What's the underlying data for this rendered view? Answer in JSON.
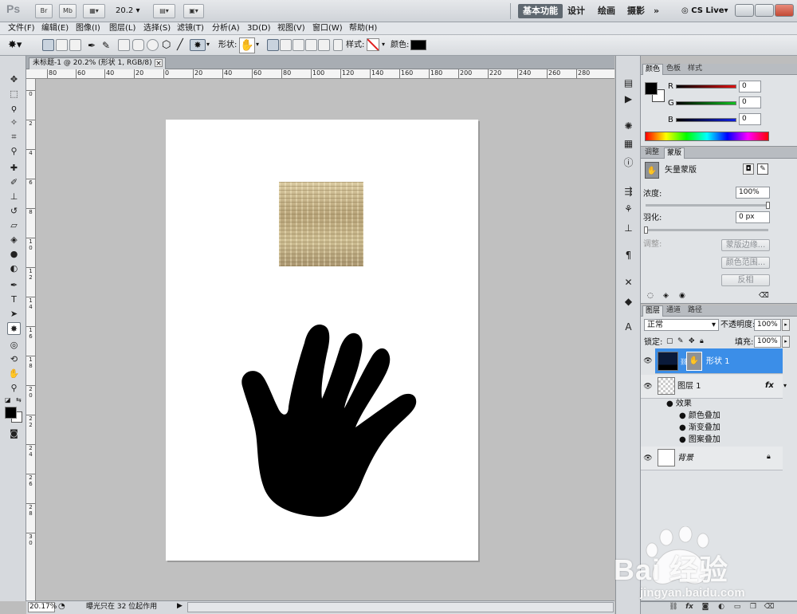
{
  "appbar": {
    "logo": "Ps",
    "br_label": "Br",
    "mb_label": "Mb",
    "zoom": "20.2",
    "workspaces": [
      "基本功能",
      "设计",
      "绘画",
      "摄影"
    ],
    "more": "»",
    "cslive": "CS Live"
  },
  "menu": [
    "文件(F)",
    "编辑(E)",
    "图像(I)",
    "图层(L)",
    "选择(S)",
    "滤镜(T)",
    "分析(A)",
    "3D(D)",
    "视图(V)",
    "窗口(W)",
    "帮助(H)"
  ],
  "options": {
    "shape_label": "形状:",
    "style_label": "样式:",
    "color_label": "颜色:",
    "color_value": "#000000"
  },
  "document": {
    "tab_title": "未标题-1 @ 20.2% (形状 1, RGB/8) *",
    "close": "×"
  },
  "rulers": {
    "h_ticks": [
      "80",
      "60",
      "40",
      "20",
      "0",
      "20",
      "40",
      "60",
      "80",
      "100",
      "120",
      "140",
      "160",
      "180",
      "200",
      "220",
      "240",
      "260",
      "280"
    ],
    "v_ticks": [
      "0",
      "2",
      "4",
      "6",
      "8",
      "1 0",
      "1 2",
      "1 4",
      "1 6",
      "1 8",
      "2 0",
      "2 2",
      "2 4",
      "2 6",
      "2 8",
      "3 0"
    ]
  },
  "status": {
    "zoom": "20.17%",
    "text": "曝光只在 32 位起作用"
  },
  "color_panel": {
    "tabs": [
      "颜色",
      "色板",
      "样式"
    ],
    "channels": [
      {
        "name": "R",
        "value": "0"
      },
      {
        "name": "G",
        "value": "0"
      },
      {
        "name": "B",
        "value": "0"
      }
    ]
  },
  "masks_panel": {
    "tabs": [
      "调整",
      "蒙版"
    ],
    "title": "矢量蒙版",
    "density_label": "浓度:",
    "density_value": "100%",
    "density_fraction": 1.0,
    "feather_label": "羽化:",
    "feather_value": "0 px",
    "refine_label": "调整:",
    "buttons": [
      "蒙版边缘...",
      "颜色范围...",
      "反相"
    ]
  },
  "layers_panel": {
    "tabs": [
      "图层",
      "通道",
      "路径"
    ],
    "blend_mode": "正常",
    "opacity_label": "不透明度:",
    "opacity_value": "100%",
    "lock_label": "锁定:",
    "fill_label": "填充:",
    "fill_value": "100%",
    "layers": [
      {
        "name": "形状 1",
        "selected": true
      },
      {
        "name": "图层 1",
        "fx": "fx"
      },
      {
        "name": "背景",
        "locked": true
      }
    ],
    "effects_label": "效果",
    "effects": [
      "颜色叠加",
      "渐变叠加",
      "图案叠加"
    ]
  },
  "watermark": {
    "brand": "Bai  经验",
    "url": "jingyan.baidu.com"
  }
}
